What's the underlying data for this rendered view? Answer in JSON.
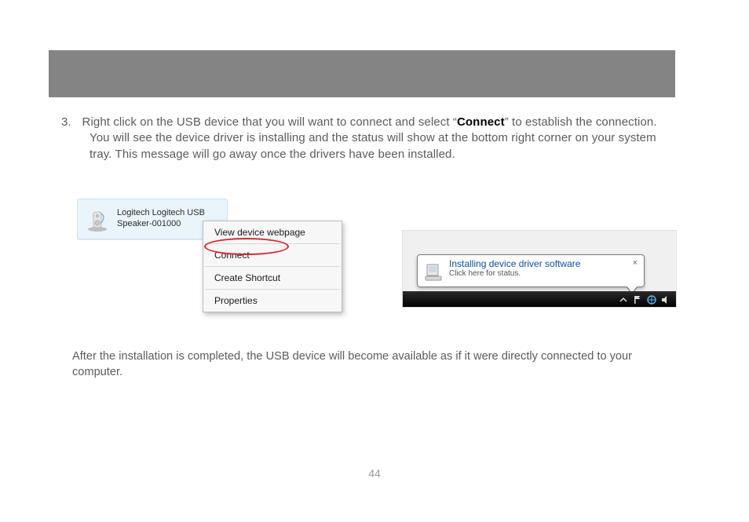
{
  "step": {
    "number": "3.",
    "text_before_bold": "Right click on the USB device that you will want to connect and select “",
    "bold_word": "Connect",
    "text_after_bold": "” to establish the connection. You will see the device driver is installing and the status will show at the bottom right corner on your system tray. This message will go away once the drivers have been installed."
  },
  "device": {
    "line1": "Logitech Logitech USB",
    "line2": "Speaker-001000"
  },
  "context_menu": {
    "items": [
      "View device webpage",
      "Connect",
      "Create Shortcut",
      "Properties"
    ]
  },
  "balloon": {
    "title": "Installing device driver software",
    "subtitle": "Click here for status.",
    "close": "×"
  },
  "after_text": "After the installation is completed, the USB device will become available as if it were directly connected to your computer.",
  "page_number": "44"
}
